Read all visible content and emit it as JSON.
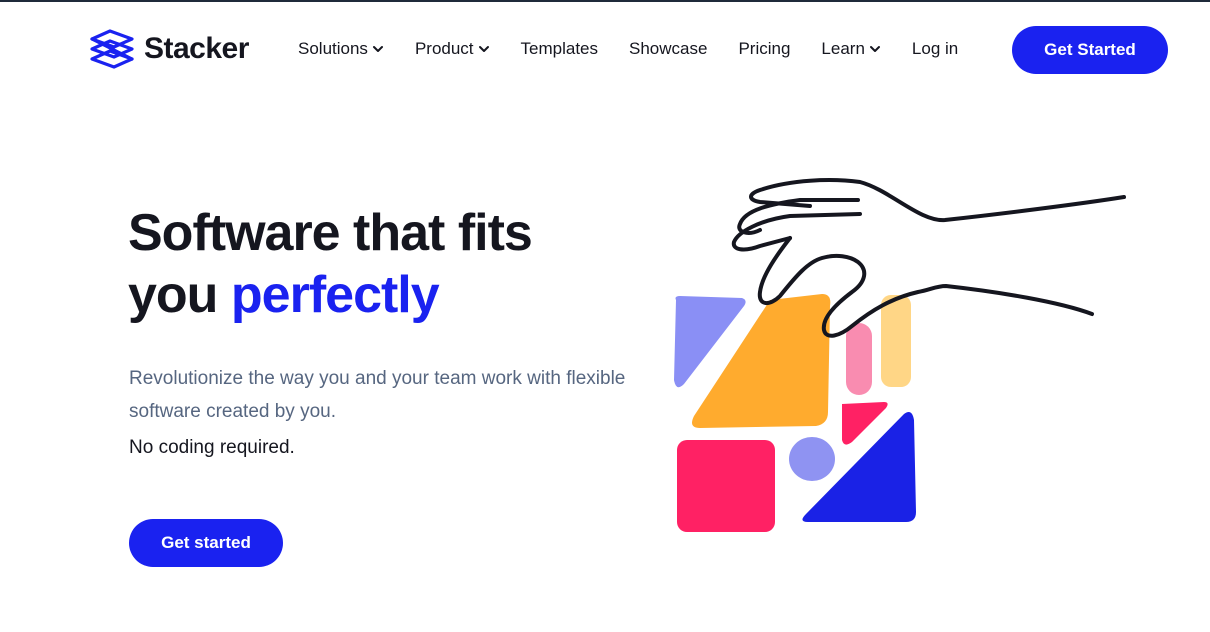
{
  "brand": {
    "name": "Stacker",
    "accent_color": "#1a22f0",
    "text_color": "#15161f",
    "muted_color": "#566680"
  },
  "nav": {
    "items": [
      {
        "label": "Solutions",
        "has_dropdown": true,
        "icon": "chevron-down-icon"
      },
      {
        "label": "Product",
        "has_dropdown": true,
        "icon": "chevron-down-icon"
      },
      {
        "label": "Templates",
        "has_dropdown": false
      },
      {
        "label": "Showcase",
        "has_dropdown": false
      },
      {
        "label": "Pricing",
        "has_dropdown": false
      },
      {
        "label": "Learn",
        "has_dropdown": true,
        "icon": "chevron-down-icon"
      }
    ],
    "login_label": "Log in",
    "cta_label": "Get Started"
  },
  "hero": {
    "title_line1": "Software that fits",
    "title_line2_plain": "you ",
    "title_line2_accent": "perfectly",
    "subtitle": "Revolutionize the way you and your team work with flexible software created by you.",
    "note": "No coding required.",
    "cta_label": "Get started"
  },
  "illustration": {
    "icon": "hand-stacking-shapes-illustration",
    "colors": {
      "lavender": "#8a8ff5",
      "orange": "#ffab2e",
      "pink": "#f98cb0",
      "peach": "#ffd686",
      "red": "#ff2164",
      "blue": "#1a22e6",
      "circle": "#8f93f2"
    }
  }
}
